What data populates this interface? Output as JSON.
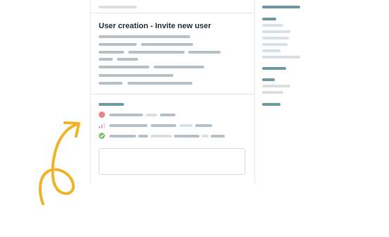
{
  "ticket": {
    "title": "User creation - Invite new user"
  },
  "colors": {
    "accent": "#6f9aa3",
    "placeholder": "#b7c1c7",
    "placeholder_light": "#d9dfe2",
    "status_error": "#e8838f",
    "status_pending": "#d9a3c6",
    "status_success": "#7cbf6a",
    "annotation_arrow": "#f0b429"
  },
  "icons": {
    "status_error": "red-dot-icon",
    "status_pending": "signal-bars-icon",
    "status_success": "check-circle-icon"
  }
}
